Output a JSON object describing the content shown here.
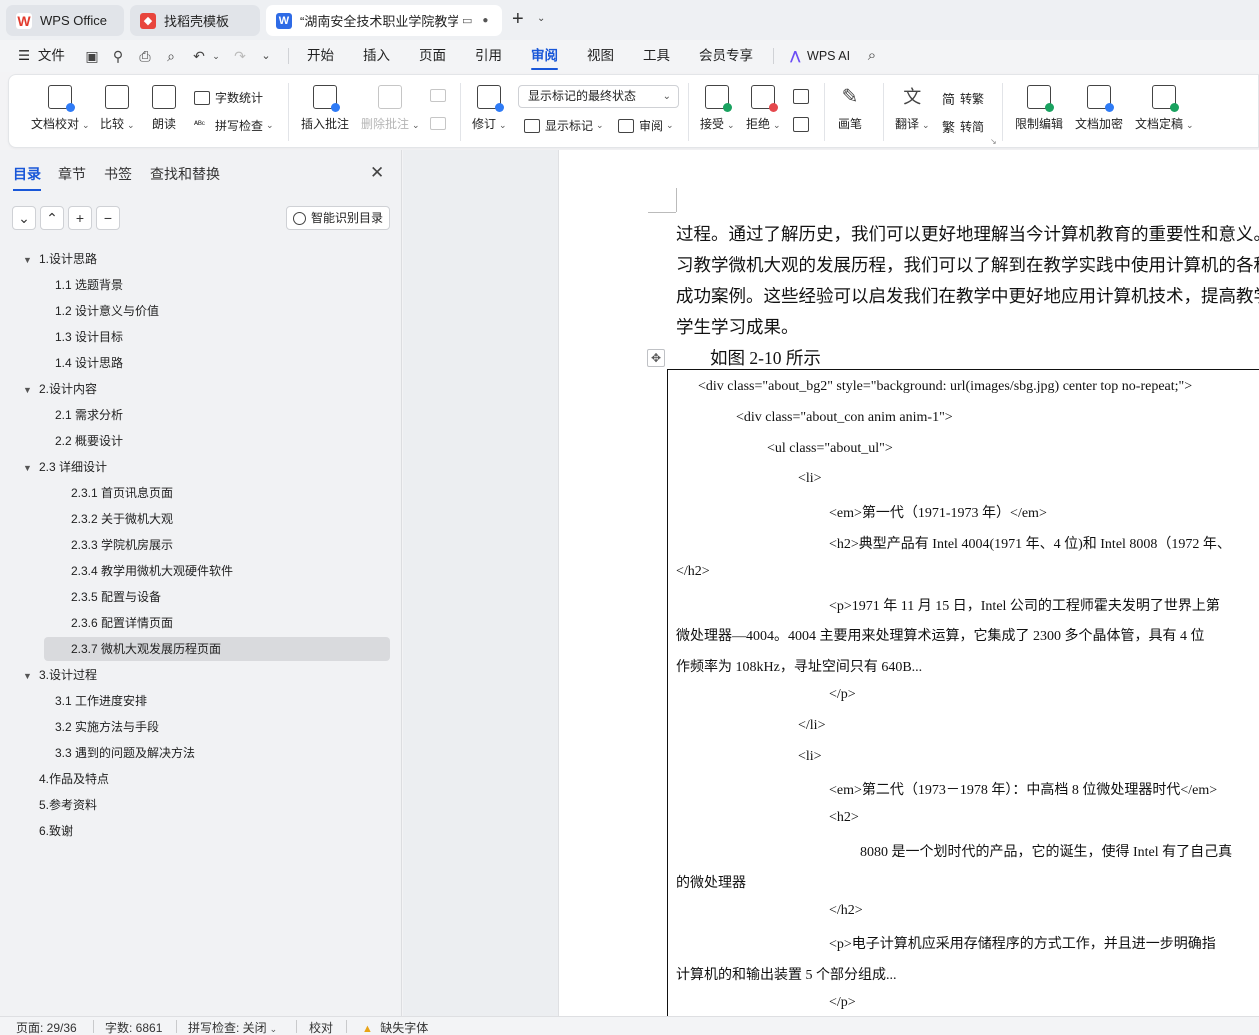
{
  "tabs": [
    {
      "label": "WPS Office",
      "icon": "wps-logo-icon"
    },
    {
      "label": "找稻壳模板",
      "icon": "daoke-icon"
    },
    {
      "label": "“湖南安全技术职业学院教学F",
      "icon": "word-doc-icon"
    }
  ],
  "menu": {
    "file": "文件",
    "items": [
      "开始",
      "插入",
      "页面",
      "引用",
      "审阅",
      "视图",
      "工具",
      "会员专享"
    ],
    "active": "审阅",
    "wps_ai": "WPS AI"
  },
  "ribbon": {
    "doc_proof": "文档校对",
    "compare": "比较",
    "read_aloud": "朗读",
    "word_count": "字数统计",
    "spell_check": "拼写检查",
    "insert_comment": "插入批注",
    "delete_comment": "删除批注",
    "revise": "修订",
    "markup_state": "显示标记的最终状态",
    "show_markup": "显示标记",
    "review_pane": "审阅",
    "accept": "接受",
    "reject": "拒绝",
    "pen": "画笔",
    "translate": "翻译",
    "to_traditional": "转繁",
    "to_simplified": "转简",
    "restrict_edit": "限制编辑",
    "doc_encrypt": "文档加密",
    "doc_finalize": "文档定稿"
  },
  "pane": {
    "tabs": [
      "目录",
      "章节",
      "书签",
      "查找和替换"
    ],
    "smart_toc": "智能识别目录"
  },
  "toc": [
    {
      "label": "1.设计思路",
      "level": 1,
      "expandable": true
    },
    {
      "label": "1.1 选题背景",
      "level": 2
    },
    {
      "label": "1.2 设计意义与价值",
      "level": 2
    },
    {
      "label": "1.3 设计目标",
      "level": 2
    },
    {
      "label": "1.4 设计思路",
      "level": 2
    },
    {
      "label": "2.设计内容",
      "level": 1,
      "expandable": true
    },
    {
      "label": "2.1 需求分析",
      "level": 2
    },
    {
      "label": "2.2 概要设计",
      "level": 2
    },
    {
      "label": "2.3 详细设计",
      "level": 1,
      "expandable": true
    },
    {
      "label": "2.3.1 首页讯息页面",
      "level": 3
    },
    {
      "label": "2.3.2 关于微机大观",
      "level": 3
    },
    {
      "label": "2.3.3 学院机房展示",
      "level": 3
    },
    {
      "label": "2.3.4 教学用微机大观硬件软件",
      "level": 3
    },
    {
      "label": "2.3.5 配置与设备",
      "level": 3
    },
    {
      "label": "2.3.6 配置详情页面",
      "level": 3
    },
    {
      "label": "2.3.7 微机大观发展历程页面",
      "level": 3,
      "selected": true
    },
    {
      "label": "3.设计过程",
      "level": 1,
      "expandable": true
    },
    {
      "label": "3.1 工作进度安排",
      "level": 2
    },
    {
      "label": "3.2 实施方法与手段",
      "level": 2
    },
    {
      "label": "3.3 遇到的问题及解决方法",
      "level": 2
    },
    {
      "label": "4.作品及特点",
      "level": 1
    },
    {
      "label": "5.参考资料",
      "level": 1
    },
    {
      "label": "6.致谢",
      "level": 1
    }
  ],
  "doc": {
    "paragraph": [
      "过程。通过了解历史，我们可以更好地理解当今计算机教育的重要性和意义。",
      "习教学微机大观的发展历程，我们可以了解到在教学实践中使用计算机的各种",
      "成功案例。这些经验可以启发我们在教学中更好地应用计算机技术，提高教学",
      "学生学习成果。"
    ],
    "figure_caption": "如图 2-10 所示",
    "code_lines": [
      "<div class=\"about_bg2\" style=\"background: url(images/sbg.jpg) center top no-repeat;\">",
      "<div  class=\"about_con anim anim-1\">",
      "<ul class=\"about_ul\">",
      "<li>",
      "<em>第一代（1971-1973 年）</em>",
      "<h2>典型产品有 Intel 4004(1971 年、4 位)和 Intel 8008（1972 年、",
      "</h2>",
      "<p>1971 年 11 月 15 日，Intel 公司的工程师霍夫发明了世界上第",
      "微处理器—4004。4004 主要用来处理算术运算，它集成了 2300 多个晶体管，具有 4 位",
      "作频率为 108kHz，寻址空间只有 640B...",
      "</p>",
      "</li>",
      "<li>",
      "<em>第二代（1973－1978 年）：中高档 8 位微处理器时代</em>",
      "<h2>",
      "8080 是一个划时代的产品，它的诞生，使得 Intel 有了自己真",
      "的微处理器",
      "</h2>",
      "<p>电子计算机应采用存储程序的方式工作，并且进一步明确指",
      "计算机的和输出装置 5 个部分组成...",
      "</p>"
    ]
  },
  "status": {
    "page": "页面: 29/36",
    "words": "字数: 6861",
    "spell": "拼写检查: 关闭",
    "proof": "校对",
    "missing_font": "缺失字体"
  }
}
